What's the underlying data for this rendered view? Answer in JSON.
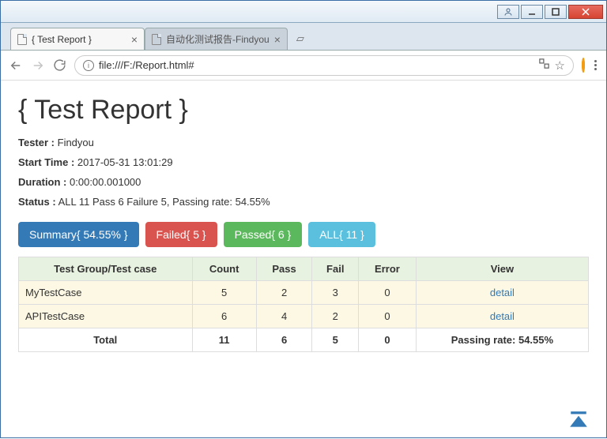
{
  "browser": {
    "tabs": [
      {
        "title": "{ Test Report }",
        "active": true
      },
      {
        "title": "自动化测试报告-Findyou",
        "active": false
      }
    ],
    "url": "file:///F:/Report.html#"
  },
  "page": {
    "title": "{ Test Report }",
    "meta": {
      "tester_label": "Tester :",
      "tester_value": "Findyou",
      "start_label": "Start Time :",
      "start_value": "2017-05-31 13:01:29",
      "duration_label": "Duration :",
      "duration_value": "0:00:00.001000",
      "status_label": "Status :",
      "status_value": "ALL 11 Pass 6 Failure 5, Passing rate: 54.55%"
    },
    "buttons": {
      "summary": "Summary{ 54.55% }",
      "failed": "Failed{ 5 }",
      "passed": "Passed{ 6 }",
      "all": "ALL{ 11 }"
    },
    "table": {
      "headers": {
        "group": "Test Group/Test case",
        "count": "Count",
        "pass": "Pass",
        "fail": "Fail",
        "error": "Error",
        "view": "View"
      },
      "rows": [
        {
          "name": "MyTestCase",
          "count": "5",
          "pass": "2",
          "fail": "3",
          "error": "0",
          "view": "detail"
        },
        {
          "name": "APITestCase",
          "count": "6",
          "pass": "4",
          "fail": "2",
          "error": "0",
          "view": "detail"
        }
      ],
      "total": {
        "label": "Total",
        "count": "11",
        "pass": "6",
        "fail": "5",
        "error": "0",
        "rate": "Passing rate: 54.55%"
      }
    }
  }
}
